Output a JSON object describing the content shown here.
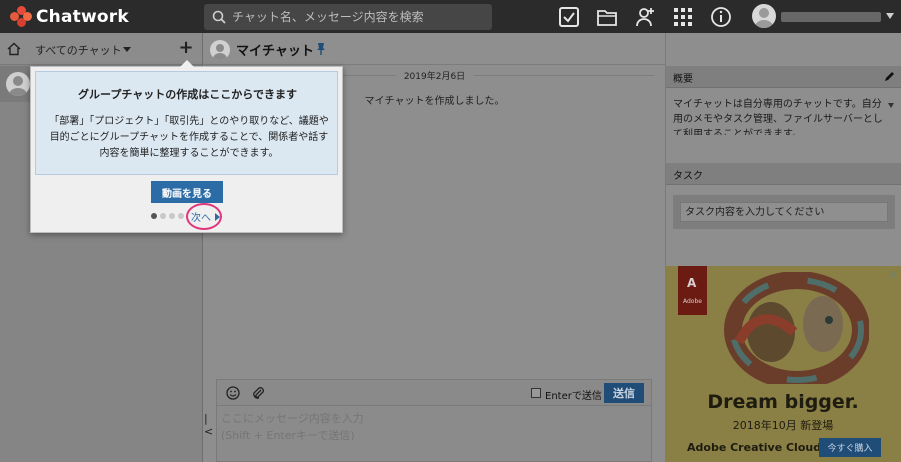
{
  "app": {
    "name": "Chatwork"
  },
  "search": {
    "placeholder": "チャット名、メッセージ内容を検索"
  },
  "header_icons": [
    "task-check-icon",
    "folder-icon",
    "add-contact-icon",
    "apps-grid-icon",
    "info-icon",
    "user-avatar"
  ],
  "sidebar": {
    "filter_label": "すべてのチャット",
    "add_label": "+"
  },
  "chat": {
    "title": "マイチャット",
    "date": "2019年2月6日",
    "system_message": "マイチャットを作成しました。"
  },
  "composer": {
    "enter_label": "Enterで送信",
    "send_label": "送信",
    "placeholder": "ここにメッセージ内容を入力\n(Shift + Enterキーで送信)"
  },
  "right": {
    "overview_title": "概要",
    "overview_text": "マイチャットは自分専用のチャットです。自分用のメモやタスク管理、ファイルサーバーとして利用することができます。",
    "task_title": "タスク",
    "task_placeholder": "タスク内容を入力してください"
  },
  "popover": {
    "title": "グループチャットの作成はここからできます",
    "body": "「部署」「プロジェクト」「取引先」とのやり取りなど、議題や目的ごとにグループチャットを作成することで、関係者や話す内容を簡単に整理することができます。",
    "video_button": "動画を見る",
    "next_label": "次へ",
    "page_count": 4,
    "current_page": 1
  },
  "ad": {
    "brand_logo": "Adobe",
    "headline": "Dream bigger.",
    "sub": "2018年10月 新登場",
    "product": "Adobe Creative Cloud",
    "buy_label": "今すぐ購入"
  },
  "colors": {
    "header": "#2b2b2b",
    "accent": "#2c6ca6",
    "send": "#1f4d78",
    "highlight": "#e0357a"
  }
}
